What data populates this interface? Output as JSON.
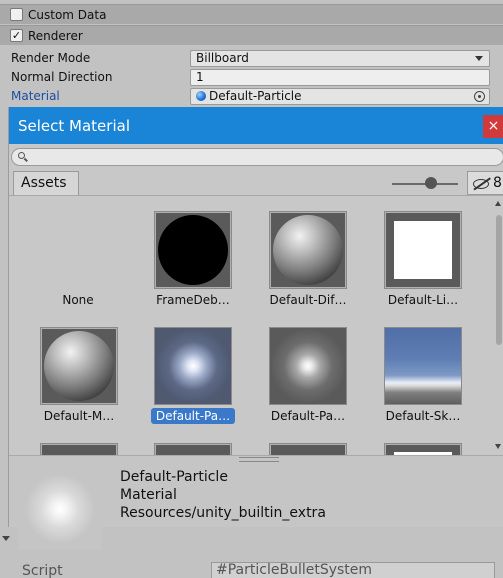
{
  "inspector": {
    "custom_data": {
      "label": "Custom Data",
      "checked": false
    },
    "renderer": {
      "label": "Renderer",
      "checked": true,
      "check_glyph": "✓"
    },
    "properties": [
      {
        "label": "Render Mode",
        "value": "Billboard"
      },
      {
        "label": "Normal Direction",
        "value": "1"
      },
      {
        "label": "Material",
        "value": "Default-Particle"
      }
    ],
    "script": {
      "label": "Script",
      "hash": "#",
      "value": "ParticleBulletSystem"
    }
  },
  "dialog": {
    "title": "Select Material",
    "close_glyph": "×",
    "search": {
      "value": "",
      "placeholder": ""
    },
    "tab_label": "Assets",
    "hidden_count": "8",
    "assets": [
      {
        "label": "None",
        "thumb": "none",
        "selected": false
      },
      {
        "label": "FrameDeb…",
        "thumb": "black-circle",
        "selected": false
      },
      {
        "label": "Default-Dif…",
        "thumb": "sphere",
        "selected": false
      },
      {
        "label": "Default-Li…",
        "thumb": "white-square",
        "selected": false
      },
      {
        "label": "Default-M…",
        "thumb": "sphere",
        "selected": false
      },
      {
        "label": "Default-Pa…",
        "thumb": "glow-blue",
        "selected": true
      },
      {
        "label": "Default-Pa…",
        "thumb": "glow-gray",
        "selected": false
      },
      {
        "label": "Default-Sk…",
        "thumb": "sky",
        "selected": false
      }
    ],
    "preview": {
      "name": "Default-Particle",
      "type": "Material",
      "path": "Resources/unity_builtin_extra"
    }
  },
  "colors": {
    "titlebar": "#1a84d7",
    "close": "#d03a3a",
    "selection": "#3a78c9",
    "link_label": "#1a4fa0"
  }
}
